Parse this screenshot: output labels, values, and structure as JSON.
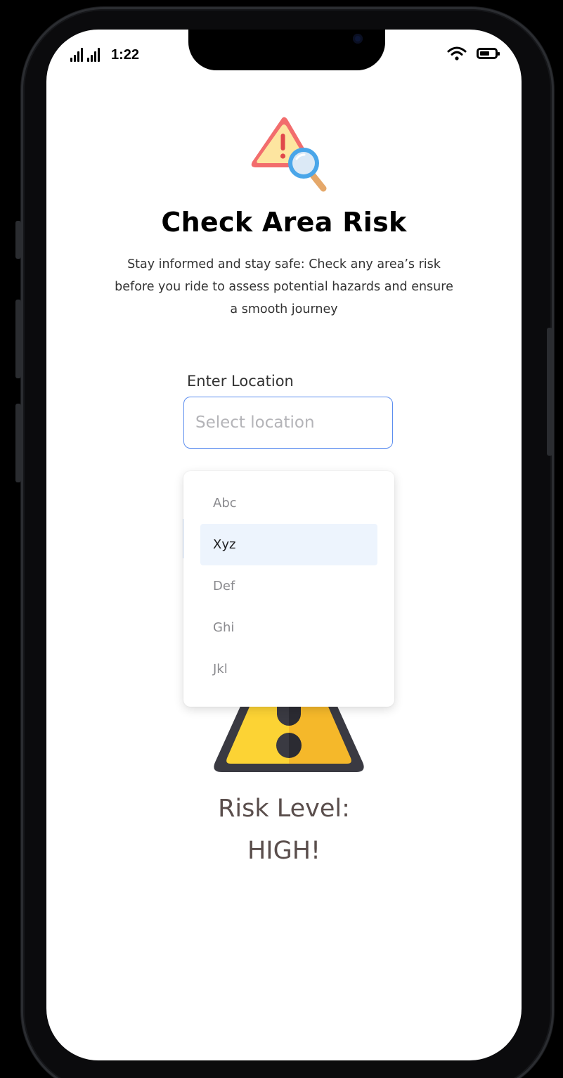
{
  "status_bar": {
    "time": "1:22",
    "icons": [
      "signal-icon",
      "signal-icon",
      "wifi-icon",
      "battery-icon"
    ],
    "battery_level": 0.65
  },
  "page": {
    "icon": "alert-search-icon",
    "title": "Check Area Risk",
    "subtitle_lines": [
      "Stay informed and stay safe: Check any area’s risk",
      "before you ride to assess potential hazards and ensure",
      "a smooth journey"
    ]
  },
  "location_field": {
    "label": "Enter Location",
    "placeholder": "Select location",
    "value": ""
  },
  "dropdown": {
    "options": [
      "Abc",
      "Xyz",
      "Def",
      "Ghi",
      "Jkl"
    ],
    "selected_index": 1
  },
  "risk": {
    "icon": "warning-sign-icon",
    "label": "Risk Level:",
    "value": "HIGH!"
  },
  "colors": {
    "accent": "#5b8def",
    "selected_bg": "#edf4fd",
    "warning_yellow": "#fcd334",
    "warning_dark": "#3a3a42",
    "alert_red": "#f26d6d",
    "risk_text": "#5a4e4c"
  }
}
